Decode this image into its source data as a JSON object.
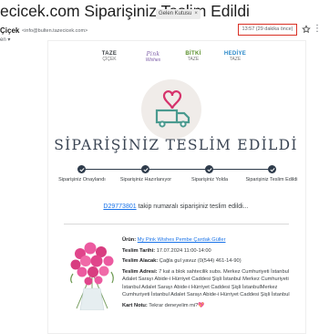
{
  "header": {
    "subject": "ecicek.com Siparişiniz Teslim Edildi",
    "label": "Gelen Kutusu",
    "label_close": "×",
    "sender_name": "Çiçek",
    "sender_email": "<info@bulten.tazecicek.com>",
    "recipient": "en ▾",
    "time": "13:57 (29 dakika önce)"
  },
  "brands": [
    {
      "line1": "TAZE",
      "line2": "ÇİÇEK"
    },
    {
      "line1": "Pink",
      "line2": "Wishes"
    },
    {
      "line1": "BİTKİ",
      "line2": "TAZE"
    },
    {
      "line1": "HEDİYE",
      "line2": "TAZE"
    }
  ],
  "email": {
    "heading": "SİPARİŞİNİZ TESLİM EDİLDİ",
    "steps": [
      "Siparişiniz Onaylandı",
      "Siparişiniz Hazırlanıyor",
      "Siparişiniz Yolda",
      "Siparişiniz Teslim Edildi"
    ],
    "order_number": "D29773801",
    "tracking_text": " takip numaralı siparişiniz teslim edildi..."
  },
  "order": {
    "product_label": "Ürün:",
    "product_name": "My Pink Wishes Pembe Çardak Güller",
    "delivery_date_label": "Teslim Tarihi:",
    "delivery_date": "17.07.2024 11:00-14:00",
    "recipient_label": "Teslim Alacak:",
    "recipient": "Çağla gul yavuz (0(544) 461-14-90)",
    "address_label": "Teslim Adresi:",
    "address": "7 kat a blok sahtecilik subs. Merkez Cumhuriyeti İstanbul Adalet Sarayı Abide-i Hürriyet Caddesi Şişli İstanbul Merkez Cumhuriyeti İstanbul Adalet Sarayı Abide-i Hürriyet Caddesi Şişli İstanbulMerkez Cumhuriyeti İstanbul Adalet Sarayı Abide-i Hürriyet Caddesi Şişli İstanbul",
    "card_note_label": "Kart Notu:",
    "card_note": "Tekrar deneyelim mi?💖"
  },
  "colors": {
    "accent_red": "#d93025",
    "navy": "#2e3b4b",
    "link": "#1a73e8",
    "heart": "#d6336c",
    "truck": "#4a9a8f"
  }
}
